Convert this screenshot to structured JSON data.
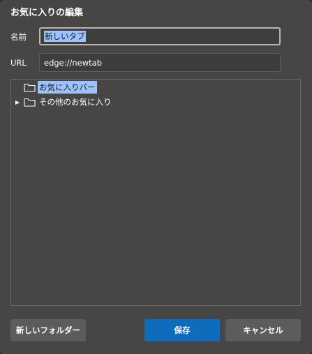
{
  "dialog": {
    "title": "お気に入りの編集",
    "name_label": "名前",
    "name_value": "新しいタブ",
    "url_label": "URL",
    "url_value": "edge://newtab"
  },
  "tree": {
    "items": [
      {
        "label": "お気に入りバー",
        "selected": true,
        "expandable": false,
        "icon": "folder-icon"
      },
      {
        "label": "その他のお気に入り",
        "selected": false,
        "expandable": true,
        "icon": "folder-icon"
      }
    ]
  },
  "buttons": {
    "new_folder": "新しいフォルダー",
    "save": "保存",
    "cancel": "キャンセル"
  },
  "colors": {
    "dialog_bg": "#484644",
    "accent": "#0f6cbd",
    "selection": "#9cc3ff"
  }
}
